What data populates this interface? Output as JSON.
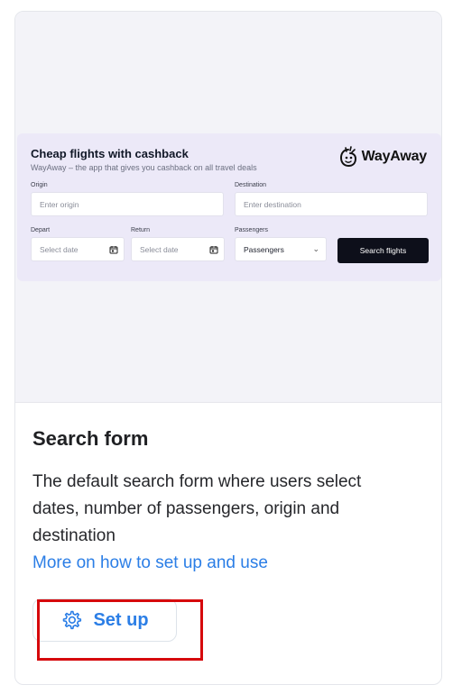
{
  "widget": {
    "title": "Cheap flights with cashback",
    "subtitle": "WayAway – the app that gives you cashback on all travel deals",
    "brand": "WayAway",
    "origin": {
      "label": "Origin",
      "placeholder": "Enter origin"
    },
    "destination": {
      "label": "Destination",
      "placeholder": "Enter destination"
    },
    "depart": {
      "label": "Depart",
      "placeholder": "Select date"
    },
    "return": {
      "label": "Return",
      "placeholder": "Select date"
    },
    "passengers": {
      "label": "Passengers",
      "value": "Passengers"
    },
    "search_button": "Search flights"
  },
  "info": {
    "title": "Search form",
    "description": "The default search form where users select dates, number of passengers, origin and destination",
    "link": "More on how to set up and use"
  },
  "setup_button": "Set up",
  "colors": {
    "accent": "#2b7ee6",
    "highlight": "#d6090c",
    "widget_bg": "#ece9f8",
    "search_button_bg": "#0d0f1a"
  }
}
